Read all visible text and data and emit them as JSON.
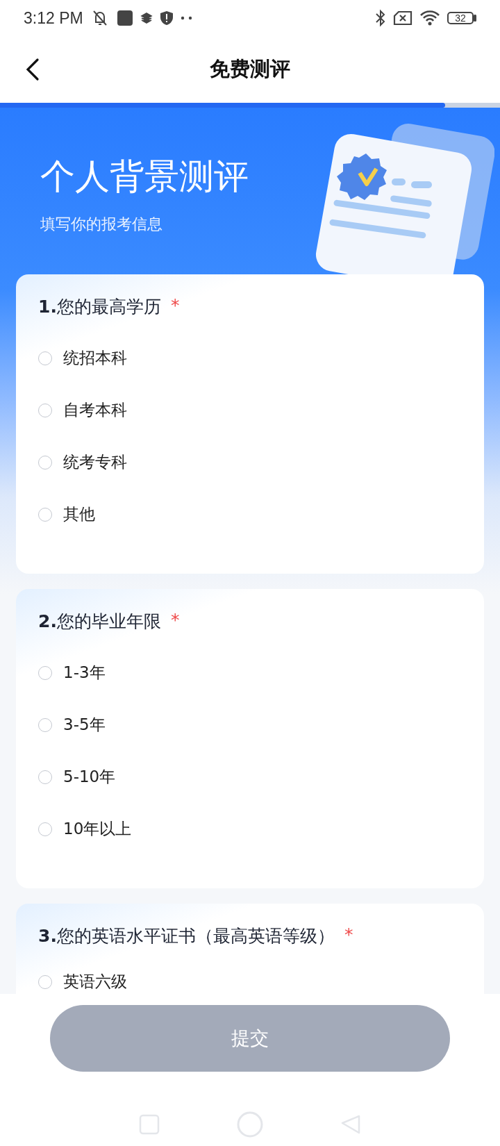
{
  "status_bar": {
    "time": "3:12 PM",
    "battery": "32"
  },
  "header": {
    "title": "免费测评"
  },
  "progress": {
    "level": 0.89
  },
  "hero": {
    "title": "个人背景测评",
    "subtitle": "填写你的报考信息"
  },
  "questions": [
    {
      "title": "**1.**您的最高学历",
      "required_mark": "*",
      "options": [
        {
          "label": "统招本科",
          "selected": false
        },
        {
          "label": "自考本科",
          "selected": false
        },
        {
          "label": "统考专科",
          "selected": false
        },
        {
          "label": "其他",
          "selected": false
        }
      ]
    },
    {
      "title": "**2.**您的毕业年限",
      "required_mark": "*",
      "options": [
        {
          "label": "1-3年",
          "selected": false
        },
        {
          "label": "3-5年",
          "selected": false
        },
        {
          "label": "5-10年",
          "selected": false
        },
        {
          "label": "10年以上",
          "selected": false
        }
      ]
    },
    {
      "title": "**3.**您的英语水平证书（最高英语等级）",
      "required_mark": "*",
      "options": [
        {
          "label": "英语六级",
          "selected": false
        }
      ]
    }
  ],
  "submit": {
    "label": "提交",
    "disabled": true
  }
}
